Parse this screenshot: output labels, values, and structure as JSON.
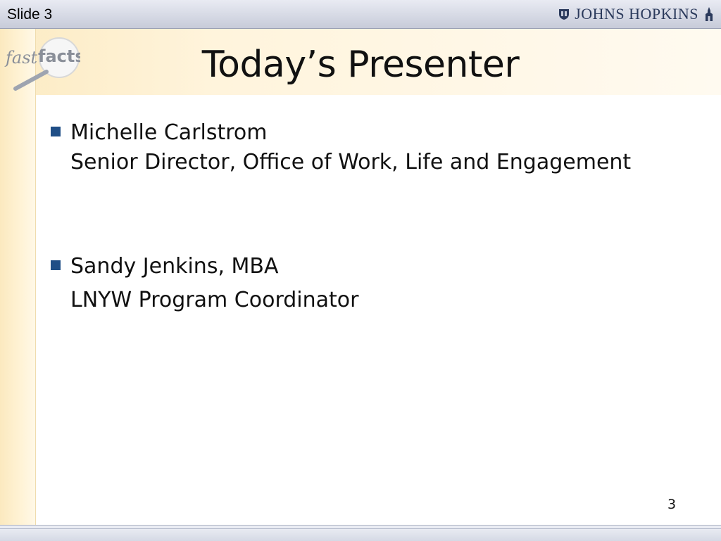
{
  "slide_label": "Slide 3",
  "brand": {
    "name": "JOHNS HOPKINS"
  },
  "logo": {
    "text_italic": "fast",
    "text_bold": "facts"
  },
  "title": "Today’s Presenter",
  "bullets": [
    {
      "line1": "Michelle Carlstrom",
      "line2": "Senior Director, Office of Work, Life and Engagement"
    },
    {
      "line1": "Sandy Jenkins, MBA",
      "line2": "LNYW Program Coordinator"
    }
  ],
  "page_number": "3",
  "colors": {
    "bullet": "#1f4e86",
    "brand": "#2b3a5c"
  }
}
